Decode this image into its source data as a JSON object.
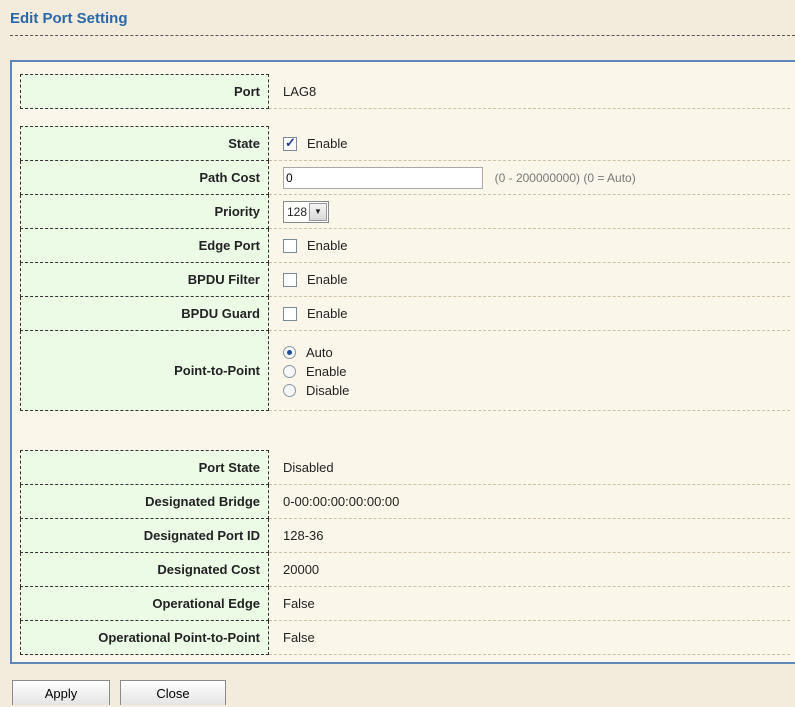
{
  "header": {
    "title": "Edit Port Setting"
  },
  "port": {
    "label": "Port",
    "value": "LAG8"
  },
  "settings": {
    "state": {
      "label": "State",
      "checked": true,
      "option": "Enable"
    },
    "path_cost": {
      "label": "Path Cost",
      "value": "0",
      "hint": "(0 - 200000000) (0 = Auto)"
    },
    "priority": {
      "label": "Priority",
      "value": "128"
    },
    "edge_port": {
      "label": "Edge Port",
      "checked": false,
      "option": "Enable"
    },
    "bpdu_filter": {
      "label": "BPDU Filter",
      "checked": false,
      "option": "Enable"
    },
    "bpdu_guard": {
      "label": "BPDU Guard",
      "checked": false,
      "option": "Enable"
    },
    "point_to_point": {
      "label": "Point-to-Point",
      "selected": "Auto",
      "options": [
        "Auto",
        "Enable",
        "Disable"
      ]
    }
  },
  "status": {
    "port_state": {
      "label": "Port State",
      "value": "Disabled"
    },
    "designated_bridge": {
      "label": "Designated Bridge",
      "value": "0-00:00:00:00:00:00"
    },
    "designated_port_id": {
      "label": "Designated Port ID",
      "value": "128-36"
    },
    "designated_cost": {
      "label": "Designated Cost",
      "value": "20000"
    },
    "operational_edge": {
      "label": "Operational Edge",
      "value": "False"
    },
    "operational_p2p": {
      "label": "Operational Point-to-Point",
      "value": "False"
    }
  },
  "buttons": {
    "apply": "Apply",
    "close": "Close"
  },
  "colors": {
    "title": "#2a67a8",
    "label_bg": "#ecfbe6",
    "page_bg": "#f3ecdc",
    "panel_border": "#5f86b8"
  }
}
